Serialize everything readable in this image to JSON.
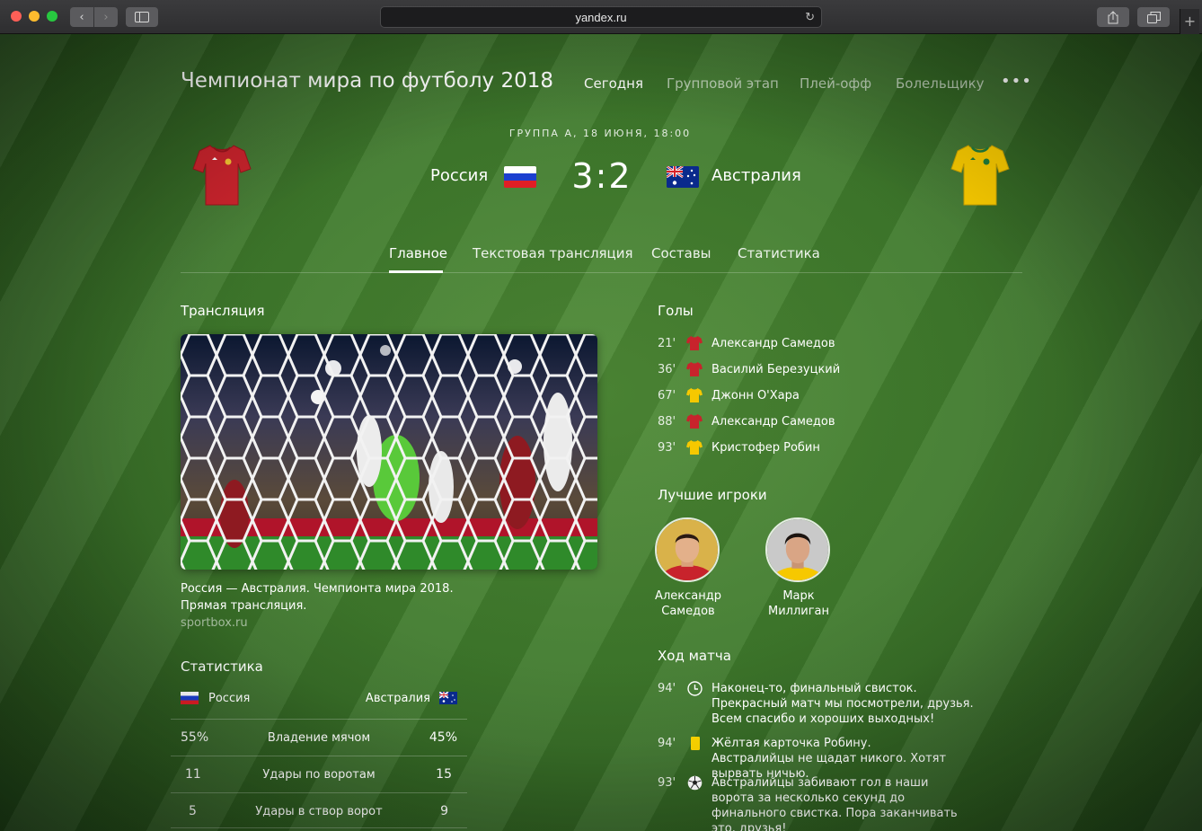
{
  "browser": {
    "url": "yandex.ru"
  },
  "header": {
    "title": "Чемпионат мира по футболу 2018",
    "nav": [
      "Сегодня",
      "Групповой этап",
      "Плей-офф",
      "Болельщику"
    ],
    "more": "•••"
  },
  "match": {
    "info": "ГРУППА А, 18 ИЮНЯ, 18:00",
    "home": {
      "name": "Россия",
      "shirt_color": "#c8232c"
    },
    "away": {
      "name": "Австралия",
      "shirt_color": "#f6c800"
    },
    "score_home": "3",
    "score_away": "2"
  },
  "tabs": [
    "Главное",
    "Текстовая трансляция",
    "Составы",
    "Статистика"
  ],
  "broadcast": {
    "heading": "Трансляция",
    "caption_line1": "Россия — Австралия. Чемпионта мира 2018.",
    "caption_line2": "Прямая трансляция.",
    "source": "sportbox.ru"
  },
  "stats": {
    "heading": "Статистика",
    "home": "Россия",
    "away": "Австралия",
    "rows": [
      {
        "home": "55%",
        "label": "Владение мячом",
        "away": "45%"
      },
      {
        "home": "11",
        "label": "Удары по воротам",
        "away": "15"
      },
      {
        "home": "5",
        "label": "Удары в створ ворот",
        "away": "9"
      }
    ]
  },
  "goals": {
    "heading": "Голы",
    "items": [
      {
        "minute": "21'",
        "team": "home",
        "player": "Александр Самедов"
      },
      {
        "minute": "36'",
        "team": "home",
        "player": "Василий Березуцкий"
      },
      {
        "minute": "67'",
        "team": "away",
        "player": "Джонн О'Хара"
      },
      {
        "minute": "88'",
        "team": "home",
        "player": "Александр Самедов"
      },
      {
        "minute": "93'",
        "team": "away",
        "player": "Кристофер Робин"
      }
    ]
  },
  "best_players": {
    "heading": "Лучшие игроки",
    "items": [
      {
        "first": "Александр",
        "last": "Самедов"
      },
      {
        "first": "Марк",
        "last": "Миллиган"
      }
    ]
  },
  "events": {
    "heading": "Ход матча",
    "items": [
      {
        "minute": "94'",
        "icon": "clock-icon",
        "text": "Наконец-то, финальный свисток. Прекрасный матч мы посмотрели, друзья. Всем спасибо и хороших выходных!"
      },
      {
        "minute": "94'",
        "icon": "yellow-card-icon",
        "text": "Жёлтая карточка Робину. Австралийцы не щадат никого. Хотят вырвать ничью."
      },
      {
        "minute": "93'",
        "icon": "soccer-ball-icon",
        "text": "Австралийцы забивают гол в наши ворота за несколько секунд до финального свистка. Пора заканчивать это, друзья!"
      }
    ]
  }
}
